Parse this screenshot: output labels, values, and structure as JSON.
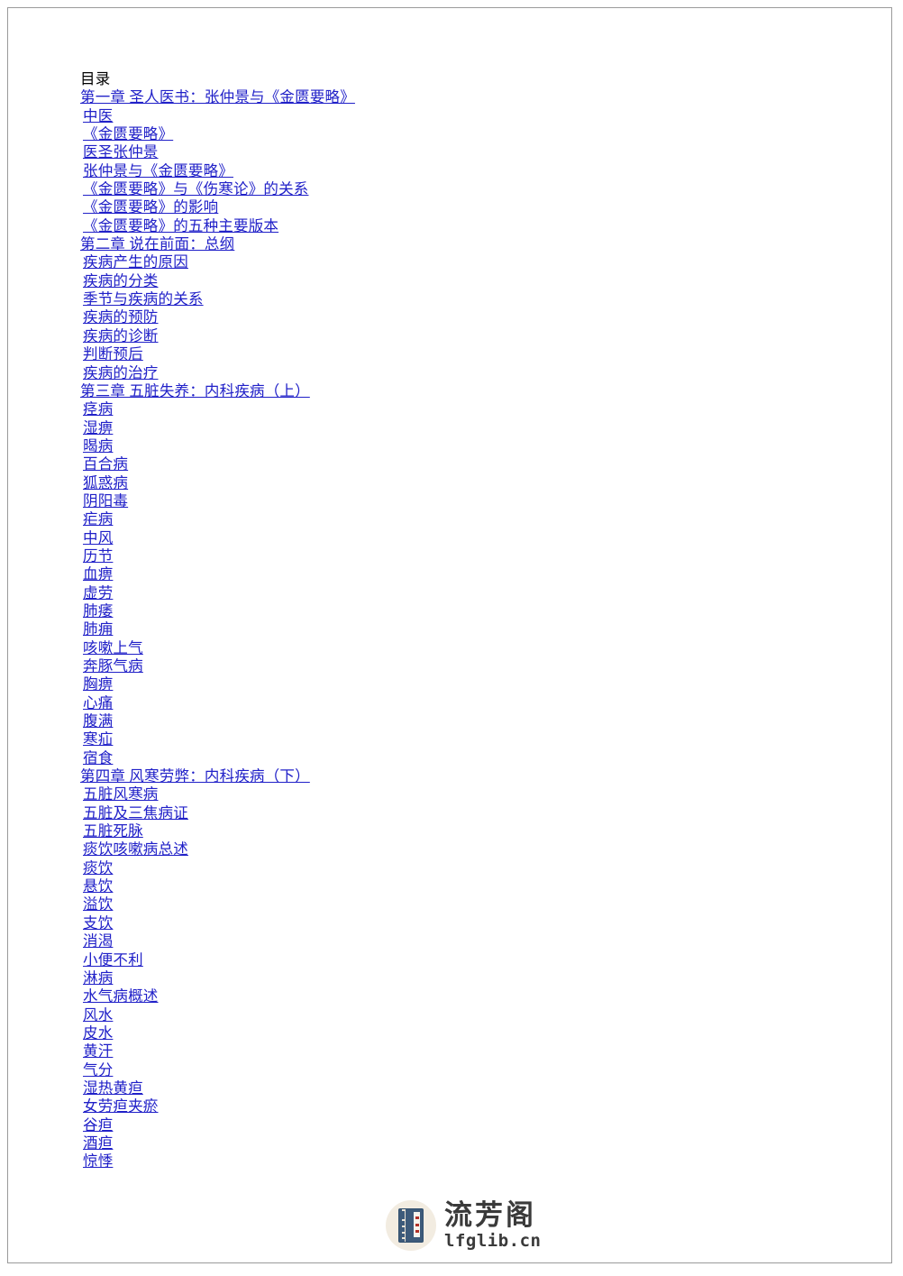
{
  "page": {
    "heading": "目录",
    "link_color": "#2020c8",
    "text_color": "#000000",
    "border_color": "#9a9a9a"
  },
  "toc": {
    "entries": [
      {
        "label": "第一章  圣人医书：张仲景与《金匮要略》",
        "level": "chapter"
      },
      {
        "label": "中医",
        "level": "section"
      },
      {
        "label": "《金匮要略》",
        "level": "section"
      },
      {
        "label": "医圣张仲景",
        "level": "section"
      },
      {
        "label": "张仲景与《金匮要略》",
        "level": "section"
      },
      {
        "label": "《金匮要略》与《伤寒论》的关系",
        "level": "section"
      },
      {
        "label": "《金匮要略》的影响",
        "level": "section"
      },
      {
        "label": "《金匮要略》的五种主要版本",
        "level": "section"
      },
      {
        "label": "第二章  说在前面：总纲",
        "level": "chapter"
      },
      {
        "label": "疾病产生的原因",
        "level": "section"
      },
      {
        "label": "疾病的分类",
        "level": "section"
      },
      {
        "label": "季节与疾病的关系",
        "level": "section"
      },
      {
        "label": "疾病的预防",
        "level": "section"
      },
      {
        "label": "疾病的诊断",
        "level": "section"
      },
      {
        "label": "判断预后",
        "level": "section"
      },
      {
        "label": "疾病的治疗",
        "level": "section"
      },
      {
        "label": "第三章  五脏失养：内科疾病（上）",
        "level": "chapter"
      },
      {
        "label": "痉病",
        "level": "section"
      },
      {
        "label": "湿痹",
        "level": "section"
      },
      {
        "label": "暍病",
        "level": "section"
      },
      {
        "label": "百合病",
        "level": "section"
      },
      {
        "label": "狐惑病",
        "level": "section"
      },
      {
        "label": "阴阳毒",
        "level": "section"
      },
      {
        "label": "疟病",
        "level": "section"
      },
      {
        "label": "中风",
        "level": "section"
      },
      {
        "label": "历节",
        "level": "section"
      },
      {
        "label": "血痹",
        "level": "section"
      },
      {
        "label": "虚劳",
        "level": "section"
      },
      {
        "label": "肺痿",
        "level": "section"
      },
      {
        "label": "肺痈",
        "level": "section"
      },
      {
        "label": "咳嗽上气",
        "level": "section"
      },
      {
        "label": "奔豚气病",
        "level": "section"
      },
      {
        "label": "胸痹",
        "level": "section"
      },
      {
        "label": "心痛",
        "level": "section"
      },
      {
        "label": "腹满",
        "level": "section"
      },
      {
        "label": "寒疝",
        "level": "section"
      },
      {
        "label": "宿食",
        "level": "section"
      },
      {
        "label": "第四章  风寒劳弊：内科疾病（下）",
        "level": "chapter"
      },
      {
        "label": "五脏风寒病",
        "level": "section"
      },
      {
        "label": "五脏及三焦病证",
        "level": "section"
      },
      {
        "label": "五脏死脉",
        "level": "section"
      },
      {
        "label": "痰饮咳嗽病总述",
        "level": "section"
      },
      {
        "label": "痰饮",
        "level": "section"
      },
      {
        "label": "悬饮",
        "level": "section"
      },
      {
        "label": "溢饮",
        "level": "section"
      },
      {
        "label": "支饮",
        "level": "section"
      },
      {
        "label": "消渴",
        "level": "section"
      },
      {
        "label": "小便不利",
        "level": "section"
      },
      {
        "label": "淋病",
        "level": "section"
      },
      {
        "label": "水气病概述",
        "level": "section"
      },
      {
        "label": "风水",
        "level": "section"
      },
      {
        "label": "皮水",
        "level": "section"
      },
      {
        "label": "黄汗",
        "level": "section"
      },
      {
        "label": "气分",
        "level": "section"
      },
      {
        "label": "湿热黄疸",
        "level": "section"
      },
      {
        "label": "女劳疸夹瘀",
        "level": "section"
      },
      {
        "label": "谷疸",
        "level": "section"
      },
      {
        "label": "酒疸",
        "level": "section"
      },
      {
        "label": "惊悸",
        "level": "section"
      }
    ]
  },
  "watermark": {
    "brand_cn": "流芳阁",
    "brand_url": "lfglib.cn",
    "icon": "thread-bound-book-icon",
    "badge_color": "#f2ece1",
    "book_color": "#3d5a7a"
  }
}
